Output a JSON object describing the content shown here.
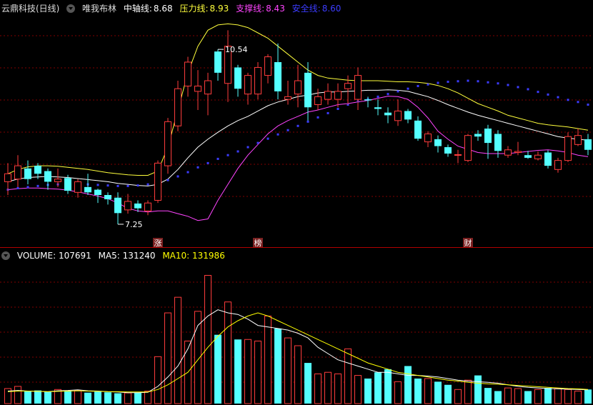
{
  "header": {
    "title": "云鼎科技(日线)",
    "indicator": "唯我布林",
    "mid_label": "中轴线:",
    "mid_value": "8.68",
    "press_label": "压力线:",
    "press_value": "8.93",
    "support_label": "支撑线:",
    "support_value": "8.43",
    "safe_label": "安全线:",
    "safe_value": "8.60"
  },
  "vol_header": {
    "vol_label": "VOLUME:",
    "vol_value": "107691",
    "ma5_label": "MA5:",
    "ma5_value": "131240",
    "ma10_label": "MA10:",
    "ma10_value": "131986"
  },
  "colors": {
    "up": "#ff3c3c",
    "down": "#54ffff",
    "mid": "#ffffff",
    "press": "#ffff3c",
    "support": "#ff44ff",
    "safe": "#3c3cff",
    "grid": "#800000",
    "ma5": "#ffffff",
    "ma10": "#ffff00"
  },
  "icons": {
    "menu": "menu-icon"
  },
  "chart_data": [
    {
      "type": "candlestick",
      "title": "云鼎科技(日线)",
      "ylim": [
        6.9,
        11.2
      ],
      "candles": [
        [
          8.05,
          8.4,
          7.8,
          8.2
        ],
        [
          8.1,
          8.55,
          7.95,
          8.35
        ],
        [
          8.3,
          8.45,
          8.0,
          8.1
        ],
        [
          8.35,
          8.4,
          8.1,
          8.2
        ],
        [
          8.25,
          8.3,
          7.9,
          8.05
        ],
        [
          8.05,
          8.3,
          7.95,
          8.1
        ],
        [
          8.12,
          8.18,
          7.82,
          7.88
        ],
        [
          7.85,
          8.1,
          7.75,
          8.05
        ],
        [
          7.95,
          8.2,
          7.8,
          7.85
        ],
        [
          7.9,
          7.92,
          7.65,
          7.8
        ],
        [
          7.8,
          7.85,
          7.62,
          7.72
        ],
        [
          7.75,
          7.85,
          7.25,
          7.46
        ],
        [
          7.52,
          7.82,
          7.45,
          7.68
        ],
        [
          7.64,
          7.7,
          7.48,
          7.55
        ],
        [
          7.5,
          7.7,
          7.42,
          7.65
        ],
        [
          7.7,
          8.45,
          7.65,
          8.4
        ],
        [
          8.35,
          9.25,
          8.2,
          9.18
        ],
        [
          9.1,
          9.95,
          9.0,
          9.8
        ],
        [
          9.85,
          10.4,
          9.65,
          10.3
        ],
        [
          9.75,
          10.15,
          9.4,
          9.85
        ],
        [
          9.7,
          10.1,
          9.3,
          9.95
        ],
        [
          10.5,
          10.54,
          9.95,
          10.1
        ],
        [
          9.9,
          10.9,
          9.55,
          10.6
        ],
        [
          10.2,
          10.25,
          9.65,
          9.8
        ],
        [
          9.7,
          10.1,
          9.5,
          10.05
        ],
        [
          9.7,
          10.3,
          9.6,
          10.2
        ],
        [
          10.05,
          10.45,
          9.9,
          10.4
        ],
        [
          10.3,
          10.65,
          9.6,
          9.75
        ],
        [
          9.6,
          9.95,
          9.5,
          9.65
        ],
        [
          9.7,
          10.25,
          9.45,
          9.95
        ],
        [
          10.1,
          10.3,
          9.2,
          9.45
        ],
        [
          9.5,
          9.8,
          9.4,
          9.65
        ],
        [
          9.6,
          9.9,
          9.5,
          9.75
        ],
        [
          9.6,
          9.9,
          9.45,
          9.75
        ],
        [
          9.8,
          10.05,
          9.5,
          9.9
        ],
        [
          9.6,
          10.2,
          9.4,
          10.05
        ],
        [
          9.6,
          9.65,
          9.45,
          9.58
        ],
        [
          9.45,
          9.6,
          9.3,
          9.42
        ],
        [
          9.35,
          9.45,
          9.15,
          9.3
        ],
        [
          9.2,
          9.6,
          9.1,
          9.38
        ],
        [
          9.38,
          9.42,
          9.15,
          9.22
        ],
        [
          9.2,
          9.28,
          8.82,
          8.86
        ],
        [
          8.8,
          9.0,
          8.7,
          8.95
        ],
        [
          8.85,
          8.92,
          8.6,
          8.72
        ],
        [
          8.7,
          8.75,
          8.52,
          8.58
        ],
        [
          8.55,
          8.65,
          8.4,
          8.56
        ],
        [
          8.45,
          8.95,
          8.42,
          8.92
        ],
        [
          8.95,
          9.02,
          8.82,
          8.9
        ],
        [
          9.05,
          9.12,
          8.48,
          8.78
        ],
        [
          8.95,
          9.02,
          8.5,
          8.63
        ],
        [
          8.55,
          8.72,
          8.5,
          8.65
        ],
        [
          8.6,
          8.8,
          8.55,
          8.62
        ],
        [
          8.55,
          8.63,
          8.48,
          8.5
        ],
        [
          8.48,
          8.62,
          8.45,
          8.55
        ],
        [
          8.6,
          8.64,
          8.3,
          8.35
        ],
        [
          8.28,
          8.5,
          8.22,
          8.45
        ],
        [
          8.45,
          8.98,
          8.42,
          8.9
        ],
        [
          8.75,
          9.05,
          8.72,
          8.92
        ],
        [
          8.85,
          8.95,
          8.55,
          8.65
        ]
      ],
      "series": [
        {
          "name": "中轴线",
          "values": [
            8.05,
            8.1,
            8.13,
            8.14,
            8.15,
            8.14,
            8.13,
            8.11,
            8.09,
            8.07,
            8.05,
            8.02,
            8.0,
            7.98,
            7.97,
            8.0,
            8.1,
            8.28,
            8.5,
            8.7,
            8.85,
            8.98,
            9.1,
            9.2,
            9.28,
            9.38,
            9.48,
            9.55,
            9.6,
            9.65,
            9.68,
            9.72,
            9.74,
            9.74,
            9.75,
            9.76,
            9.77,
            9.77,
            9.78,
            9.77,
            9.75,
            9.7,
            9.65,
            9.58,
            9.5,
            9.43,
            9.36,
            9.3,
            9.25,
            9.2,
            9.15,
            9.1,
            9.05,
            9.0,
            8.95,
            8.9,
            8.87,
            8.85,
            8.83
          ]
        },
        {
          "name": "压力线",
          "values": [
            8.2,
            8.28,
            8.33,
            8.35,
            8.35,
            8.34,
            8.32,
            8.3,
            8.28,
            8.25,
            8.22,
            8.2,
            8.18,
            8.17,
            8.17,
            8.25,
            8.7,
            9.4,
            10.1,
            10.6,
            10.9,
            11.0,
            11.02,
            11.0,
            10.95,
            10.85,
            10.75,
            10.6,
            10.45,
            10.3,
            10.15,
            10.05,
            10.0,
            9.98,
            9.96,
            9.95,
            9.95,
            9.95,
            9.94,
            9.93,
            9.93,
            9.92,
            9.9,
            9.86,
            9.8,
            9.72,
            9.62,
            9.52,
            9.45,
            9.38,
            9.3,
            9.25,
            9.2,
            9.15,
            9.12,
            9.1,
            9.08,
            9.05,
            9.02
          ]
        },
        {
          "name": "支撑线",
          "values": [
            7.9,
            7.92,
            7.93,
            7.93,
            7.92,
            7.91,
            7.89,
            7.86,
            7.82,
            7.78,
            7.73,
            7.65,
            7.55,
            7.5,
            7.48,
            7.5,
            7.5,
            7.45,
            7.4,
            7.32,
            7.35,
            7.7,
            8.0,
            8.3,
            8.55,
            8.75,
            8.95,
            9.1,
            9.2,
            9.28,
            9.36,
            9.4,
            9.45,
            9.5,
            9.52,
            9.55,
            9.58,
            9.62,
            9.66,
            9.65,
            9.6,
            9.45,
            9.25,
            9.0,
            8.85,
            8.72,
            8.66,
            8.6,
            8.58,
            8.58,
            8.58,
            8.6,
            8.62,
            8.64,
            8.65,
            8.63,
            8.6,
            8.55,
            8.52
          ]
        },
        {
          "name": "安全线",
          "values": [
            7.9,
            7.93,
            7.95,
            7.97,
            7.99,
            8.0,
            8.01,
            8.01,
            8.0,
            7.99,
            7.98,
            7.97,
            7.97,
            7.98,
            8.0,
            8.03,
            8.08,
            8.15,
            8.23,
            8.32,
            8.4,
            8.48,
            8.55,
            8.62,
            8.7,
            8.78,
            8.86,
            8.94,
            9.02,
            9.1,
            9.18,
            9.26,
            9.34,
            9.42,
            9.5,
            9.56,
            9.6,
            9.65,
            9.7,
            9.75,
            9.8,
            9.85,
            9.88,
            9.91,
            9.93,
            9.94,
            9.95,
            9.94,
            9.92,
            9.9,
            9.87,
            9.83,
            9.79,
            9.74,
            9.69,
            9.64,
            9.59,
            9.55,
            9.5
          ]
        }
      ],
      "annotations": [
        {
          "text": "10.54",
          "x": 21,
          "y": 10.54
        },
        {
          "text": "7.25",
          "x": 11,
          "y": 7.25
        }
      ],
      "event_labels": [
        {
          "text": "涨",
          "x": 15
        },
        {
          "text": "榜",
          "x": 25
        },
        {
          "text": "财",
          "x": 46
        }
      ],
      "grid": true
    },
    {
      "type": "bar",
      "title": "VOLUME",
      "ylim": [
        0,
        450000
      ],
      "values": [
        48000,
        55000,
        40000,
        42000,
        38000,
        45000,
        40000,
        42000,
        35000,
        38000,
        36000,
        33000,
        34000,
        35000,
        40000,
        150000,
        290000,
        340000,
        200000,
        295000,
        410000,
        220000,
        325000,
        205000,
        205000,
        200000,
        280000,
        240000,
        210000,
        185000,
        130000,
        95000,
        100000,
        95000,
        175000,
        90000,
        80000,
        100000,
        110000,
        70000,
        120000,
        80000,
        80000,
        70000,
        60000,
        45000,
        75000,
        90000,
        50000,
        40000,
        50000,
        48000,
        40000,
        45000,
        50000,
        48000,
        45000,
        40000,
        45000
      ],
      "series": [
        {
          "name": "MA5",
          "values": [
            40000,
            42000,
            40000,
            39000,
            38000,
            41000,
            42000,
            44000,
            41000,
            40000,
            38000,
            37000,
            35000,
            35000,
            36000,
            55000,
            85000,
            120000,
            175000,
            250000,
            280000,
            300000,
            290000,
            285000,
            270000,
            250000,
            245000,
            240000,
            235000,
            225000,
            210000,
            180000,
            160000,
            140000,
            130000,
            120000,
            110000,
            100000,
            100000,
            95000,
            90000,
            90000,
            88000,
            85000,
            80000,
            75000,
            72000,
            70000,
            68000,
            65000,
            60000,
            55000,
            52000,
            50000,
            48000,
            47000,
            46000,
            45000,
            44000
          ]
        },
        {
          "name": "MA10",
          "values": [
            38000,
            40000,
            40000,
            39000,
            38000,
            39000,
            40000,
            41000,
            40000,
            39000,
            38000,
            38000,
            37000,
            37000,
            37000,
            45000,
            60000,
            80000,
            100000,
            140000,
            180000,
            215000,
            245000,
            265000,
            280000,
            290000,
            280000,
            265000,
            250000,
            235000,
            220000,
            205000,
            190000,
            175000,
            160000,
            145000,
            130000,
            120000,
            110000,
            100000,
            95000,
            90000,
            85000,
            80000,
            75000,
            72000,
            68000,
            65000,
            63000,
            62000,
            60000,
            58000,
            56000,
            54000,
            52000,
            50000,
            48000,
            47000,
            45000
          ]
        }
      ],
      "grid": true
    }
  ]
}
